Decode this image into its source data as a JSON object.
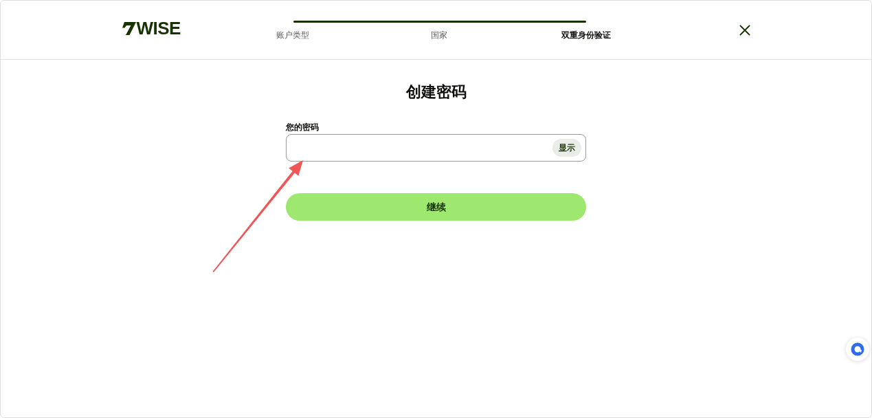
{
  "logo": {
    "text": "WISE"
  },
  "progress": {
    "level": 1,
    "steps": [
      {
        "label": "账户类型",
        "selected": false
      },
      {
        "label": "国家",
        "selected": false
      },
      {
        "label": "双重身份验证",
        "selected": true
      }
    ]
  },
  "form": {
    "title": "创建密码",
    "password_field": {
      "label": "您的密码",
      "show_button": "显示"
    },
    "continue_button": "继续"
  }
}
